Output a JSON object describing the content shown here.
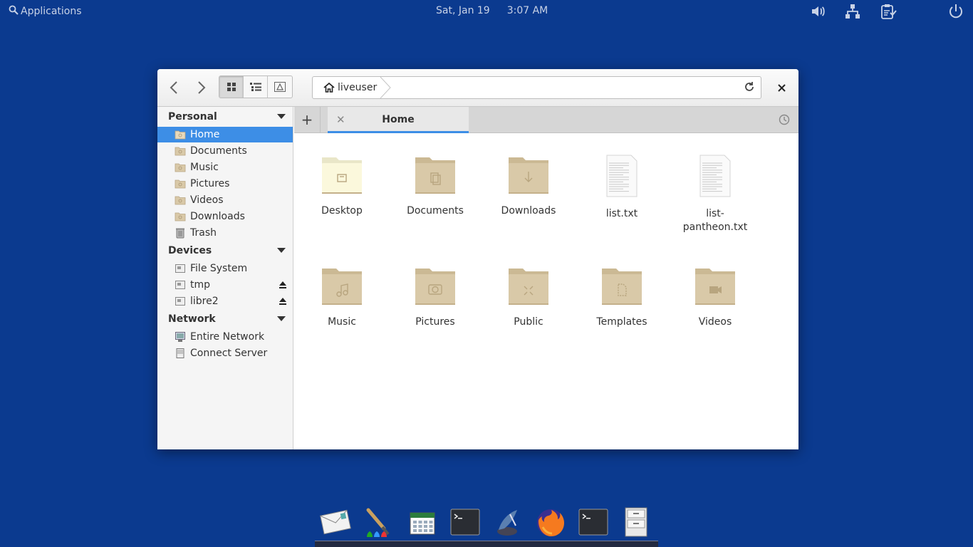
{
  "top_panel": {
    "applications_label": "Applications",
    "date": "Sat, Jan 19",
    "time": "3:07 AM"
  },
  "window": {
    "path": {
      "home_crumb": "liveuser"
    },
    "sidebar": {
      "personal_header": "Personal",
      "personal_items": [
        {
          "label": "Home",
          "icon": "folder-home-icon",
          "selected": true
        },
        {
          "label": "Documents",
          "icon": "folder-documents-icon"
        },
        {
          "label": "Music",
          "icon": "folder-music-icon"
        },
        {
          "label": "Pictures",
          "icon": "folder-pictures-icon"
        },
        {
          "label": "Videos",
          "icon": "folder-videos-icon"
        },
        {
          "label": "Downloads",
          "icon": "folder-downloads-icon"
        },
        {
          "label": "Trash",
          "icon": "trash-icon"
        }
      ],
      "devices_header": "Devices",
      "device_items": [
        {
          "label": "File System",
          "icon": "drive-icon"
        },
        {
          "label": "tmp",
          "icon": "drive-icon",
          "ejectable": true
        },
        {
          "label": "libre2",
          "icon": "drive-icon",
          "ejectable": true
        }
      ],
      "network_header": "Network",
      "network_items": [
        {
          "label": "Entire Network",
          "icon": "network-icon"
        },
        {
          "label": "Connect Server",
          "icon": "server-icon"
        }
      ]
    },
    "tabs": {
      "new_tab_label": "+",
      "active_tab": "Home"
    },
    "files": [
      {
        "label": "Desktop",
        "type": "folder-desktop"
      },
      {
        "label": "Documents",
        "type": "folder-documents"
      },
      {
        "label": "Downloads",
        "type": "folder-downloads"
      },
      {
        "label": "list.txt",
        "type": "text-file"
      },
      {
        "label": "list-\npantheon.txt",
        "type": "text-file"
      },
      {
        "label": "Music",
        "type": "folder-music"
      },
      {
        "label": "Pictures",
        "type": "folder-pictures"
      },
      {
        "label": "Public",
        "type": "folder-public"
      },
      {
        "label": "Templates",
        "type": "folder-templates"
      },
      {
        "label": "Videos",
        "type": "folder-videos"
      }
    ]
  },
  "dock": {
    "items": [
      "mail-icon",
      "paint-icon",
      "calendar-icon",
      "terminal-icon",
      "installer-icon",
      "firefox-icon",
      "terminal-icon",
      "file-cabinet-icon"
    ]
  },
  "colors": {
    "desktop_bg": "#0b3a8f",
    "accent": "#3d8ee6",
    "folder": "#d9c9a8"
  }
}
